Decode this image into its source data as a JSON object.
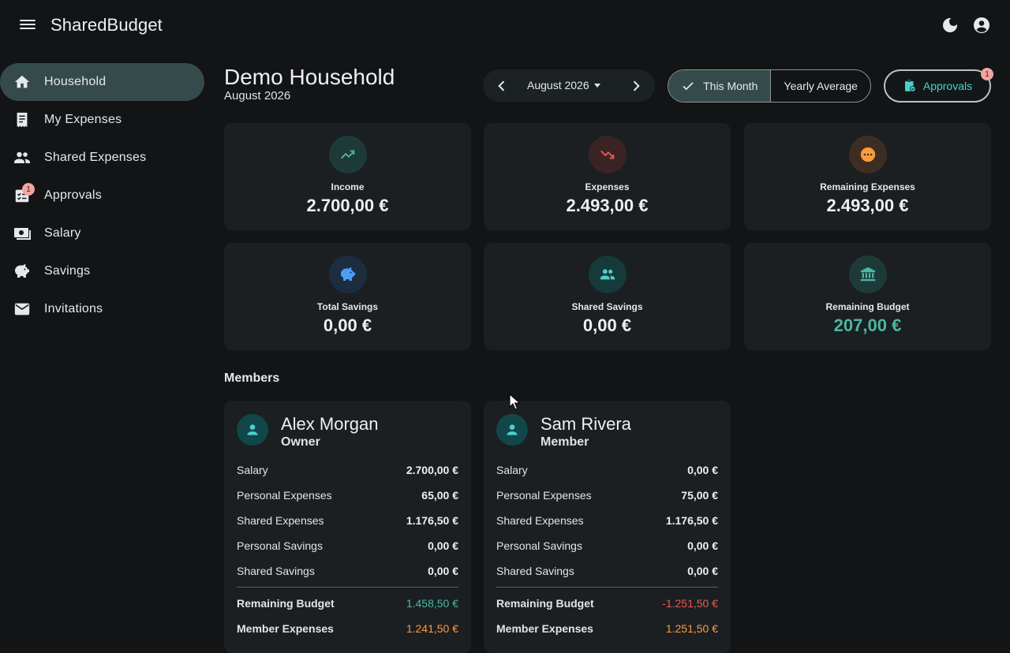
{
  "app": {
    "title": "SharedBudget"
  },
  "sidebar": {
    "items": [
      {
        "label": "Household",
        "icon": "home-icon",
        "active": true
      },
      {
        "label": "My Expenses",
        "icon": "receipt-icon"
      },
      {
        "label": "Shared Expenses",
        "icon": "people-icon"
      },
      {
        "label": "Approvals",
        "icon": "approval-icon",
        "badge": "1"
      },
      {
        "label": "Salary",
        "icon": "salary-icon"
      },
      {
        "label": "Savings",
        "icon": "piggy-bank-icon"
      },
      {
        "label": "Invitations",
        "icon": "mail-icon"
      }
    ]
  },
  "header": {
    "title": "Demo Household",
    "subtitle": "August 2026",
    "month_picker": {
      "label": "August 2026"
    },
    "view_toggle": {
      "selected": "This Month",
      "other": "Yearly Average"
    },
    "approvals": {
      "label": "Approvals",
      "badge": "1"
    }
  },
  "stats": [
    {
      "label": "Income",
      "value": "2.700,00 €",
      "icon": "trending-up-icon",
      "color": "#4db6a4"
    },
    {
      "label": "Expenses",
      "value": "2.493,00 €",
      "icon": "trending-down-icon",
      "color": "#e85a4f"
    },
    {
      "label": "Remaining Expenses",
      "value": "2.493,00 €",
      "icon": "pending-icon",
      "color": "#ff9a3c"
    },
    {
      "label": "Total Savings",
      "value": "0,00 €",
      "icon": "piggy-bank-icon",
      "color": "#4a9ff5"
    },
    {
      "label": "Shared Savings",
      "value": "0,00 €",
      "icon": "group-icon",
      "color": "#4dd0c8"
    },
    {
      "label": "Remaining Budget",
      "value": "207,00 €",
      "icon": "bank-icon",
      "color": "#4db6a4"
    }
  ],
  "members_title": "Members",
  "members": [
    {
      "name": "Alex Morgan",
      "role": "Owner",
      "rows": [
        {
          "k": "Salary",
          "v": "2.700,00 €"
        },
        {
          "k": "Personal Expenses",
          "v": "65,00 €"
        },
        {
          "k": "Shared Expenses",
          "v": "1.176,50 €"
        },
        {
          "k": "Personal Savings",
          "v": "0,00 €"
        },
        {
          "k": "Shared Savings",
          "v": "0,00 €"
        }
      ],
      "remaining_budget": {
        "k": "Remaining Budget",
        "v": "1.458,50 €"
      },
      "member_expenses": {
        "k": "Member Expenses",
        "v": "1.241,50 €"
      }
    },
    {
      "name": "Sam Rivera",
      "role": "Member",
      "rows": [
        {
          "k": "Salary",
          "v": "0,00 €"
        },
        {
          "k": "Personal Expenses",
          "v": "75,00 €"
        },
        {
          "k": "Shared Expenses",
          "v": "1.176,50 €"
        },
        {
          "k": "Personal Savings",
          "v": "0,00 €"
        },
        {
          "k": "Shared Savings",
          "v": "0,00 €"
        }
      ],
      "remaining_budget": {
        "k": "Remaining Budget",
        "v": "-1.251,50 €"
      },
      "member_expenses": {
        "k": "Member Expenses",
        "v": "1.251,50 €"
      }
    }
  ],
  "colors": {
    "accent": "#4dd0c8",
    "positive": "#4db6a4",
    "negative": "#e85a4f",
    "warning": "#ff9a3c",
    "active_nav": "#354b4b"
  }
}
